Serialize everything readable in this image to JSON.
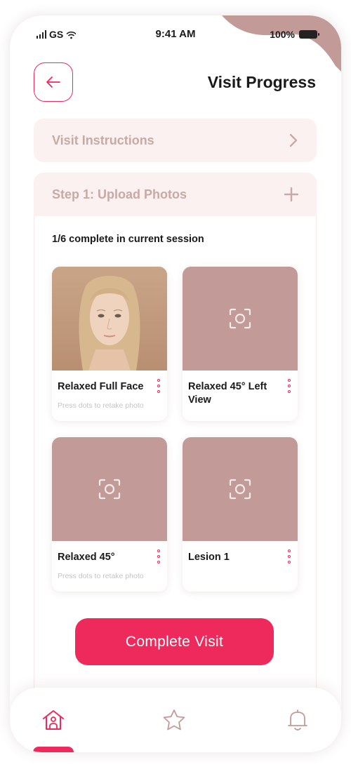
{
  "status_bar": {
    "carrier": "GS",
    "time": "9:41 AM",
    "battery": "100%"
  },
  "header": {
    "title": "Visit Progress",
    "back_icon": "arrow-left-icon"
  },
  "sections": [
    {
      "label": "Visit Instructions",
      "icon": "chevron-right-icon"
    },
    {
      "label": "Step 1: Upload Photos",
      "icon": "plus-icon"
    }
  ],
  "progress": {
    "text": "1/6 complete in current session",
    "completed": 1,
    "total": 6
  },
  "photos": [
    {
      "title": "Relaxed Full Face",
      "hint": "Press dots to retake photo",
      "has_photo": true
    },
    {
      "title": "Relaxed 45° Left View",
      "hint": "",
      "has_photo": false
    },
    {
      "title": "Relaxed 45°",
      "hint": "Press dots to retake photo",
      "has_photo": false
    },
    {
      "title": "Lesion 1",
      "hint": "",
      "has_photo": false
    }
  ],
  "complete_button": {
    "label": "Complete Visit"
  },
  "bottom_nav": [
    {
      "icon": "home-icon",
      "active": true
    },
    {
      "icon": "star-icon",
      "active": false
    },
    {
      "icon": "bell-icon",
      "active": false
    }
  ],
  "colors": {
    "accent": "#ee2a5c",
    "placeholder": "#c29b98",
    "section_bg": "#fbf1f0",
    "section_text": "#c8a9a5",
    "blob": "#c29b98"
  }
}
